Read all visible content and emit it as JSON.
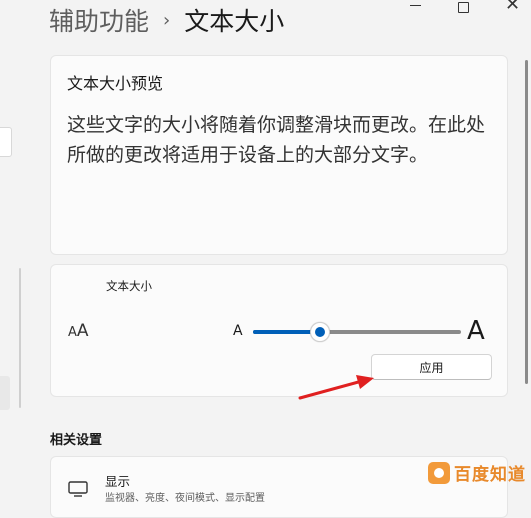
{
  "breadcrumb": {
    "parent": "辅助功能",
    "separator": "›",
    "current": "文本大小"
  },
  "window_controls": {
    "close_glyph": "✕"
  },
  "preview": {
    "title": "文本大小预览",
    "text": "这些文字的大小将随着你调整滑块而更改。在此处所做的更改将适用于设备上的大部分文字。"
  },
  "text_size": {
    "label": "文本大小",
    "icon_small": "A",
    "icon_big": "A",
    "slider_min_label": "A",
    "slider_max_label": "A",
    "slider_value_fraction": 0.32,
    "apply_label": "应用"
  },
  "related": {
    "heading": "相关设置",
    "items": [
      {
        "title": "显示",
        "description": "监视器、亮度、夜间模式、显示配置",
        "icon": "monitor-icon"
      }
    ]
  },
  "watermark": {
    "text": "百度知道"
  },
  "colors": {
    "accent": "#005fb8",
    "annotation_red": "#e02020",
    "watermark_orange": "#e8892b"
  }
}
